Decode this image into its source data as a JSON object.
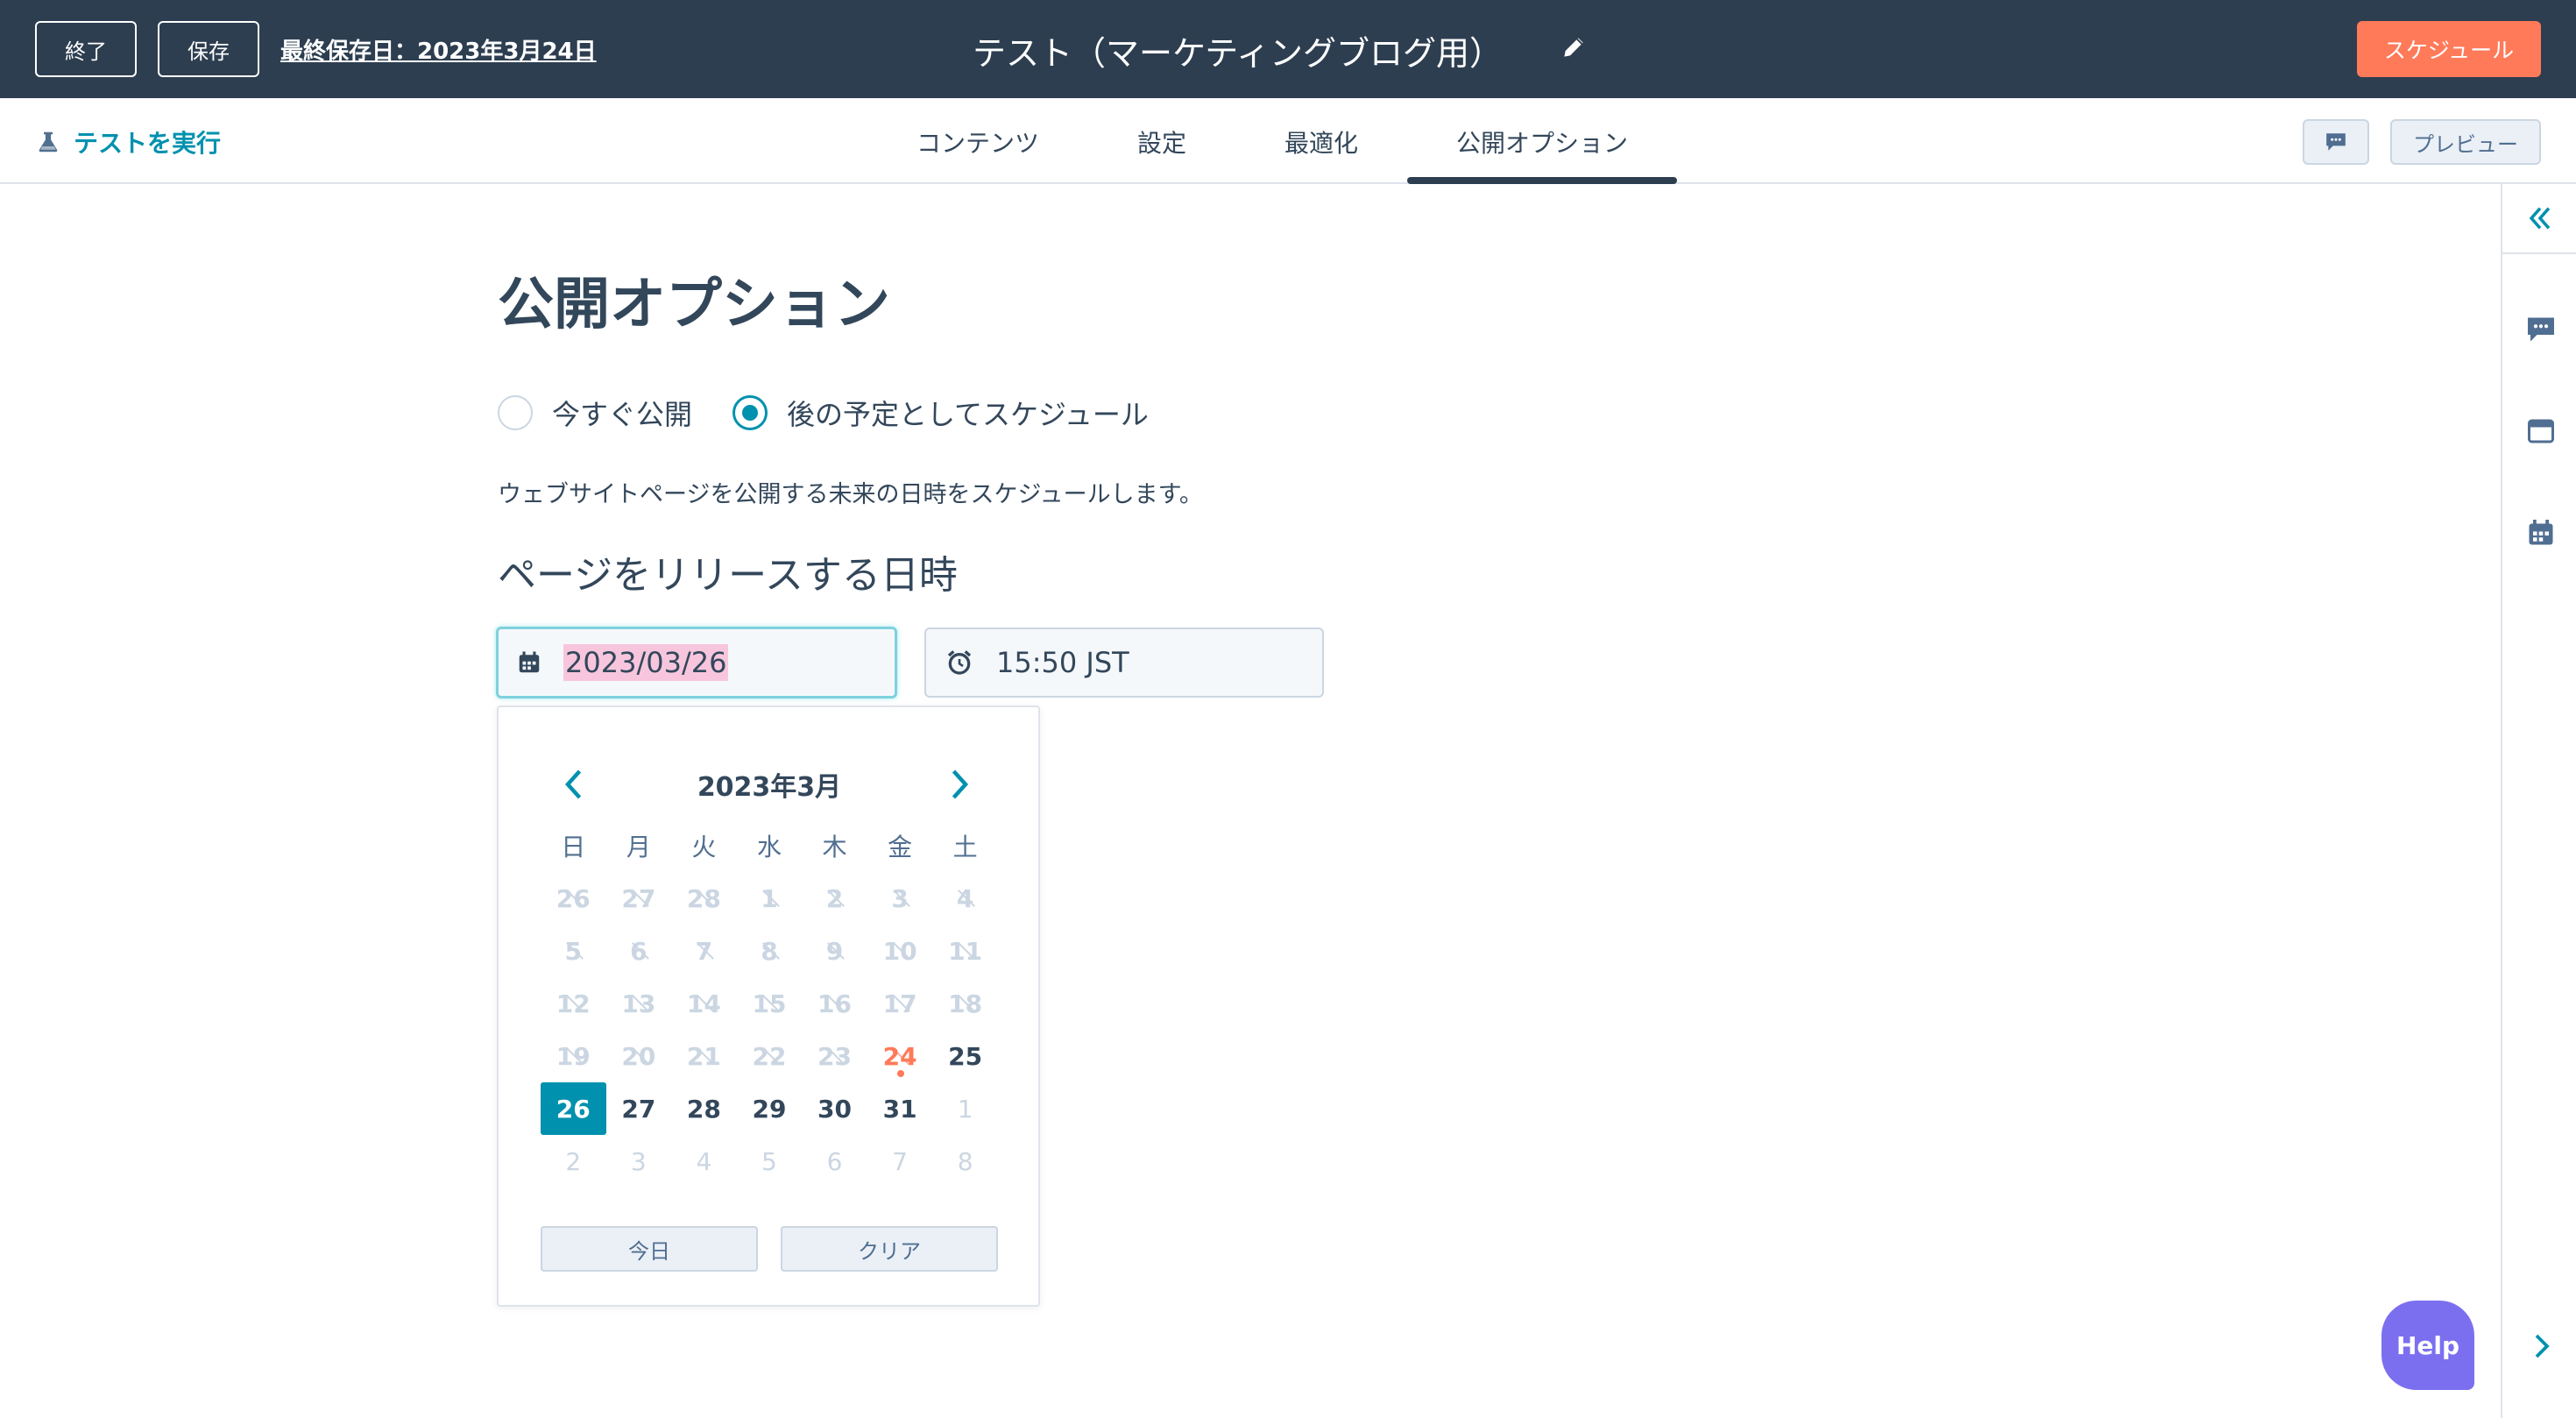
{
  "topbar": {
    "exit_label": "終了",
    "save_label": "保存",
    "last_saved": "最終保存日：2023年3月24日",
    "title": "テスト（マーケティングブログ用）",
    "schedule_label": "スケジュール"
  },
  "tabbar": {
    "run_test_label": "テストを実行",
    "tabs": [
      "コンテンツ",
      "設定",
      "最適化",
      "公開オプション"
    ],
    "active_tab": "公開オプション",
    "preview_label": "プレビュー"
  },
  "main": {
    "heading": "公開オプション",
    "radio_publish_now": "今すぐ公開",
    "radio_schedule_later": "後の予定としてスケジュール",
    "selected_option": "後の予定としてスケジュール",
    "description": "ウェブサイトページを公開する未来の日時をスケジュールします。",
    "subheading": "ページをリリースする日時",
    "date_value": "2023/03/26",
    "time_value": "15:50 JST"
  },
  "calendar": {
    "month_label": "2023年3月",
    "weekdays": [
      "日",
      "月",
      "火",
      "水",
      "木",
      "金",
      "土"
    ],
    "weeks": [
      [
        "26",
        "27",
        "28",
        "1",
        "2",
        "3",
        "4"
      ],
      [
        "5",
        "6",
        "7",
        "8",
        "9",
        "10",
        "11"
      ],
      [
        "12",
        "13",
        "14",
        "15",
        "16",
        "17",
        "18"
      ],
      [
        "19",
        "20",
        "21",
        "22",
        "23",
        "24",
        "25"
      ],
      [
        "26",
        "27",
        "28",
        "29",
        "30",
        "31",
        "1"
      ],
      [
        "2",
        "3",
        "4",
        "5",
        "6",
        "7",
        "8"
      ]
    ],
    "today_label": "今日",
    "clear_label": "クリア",
    "today_day": "24",
    "selected_day": "26"
  },
  "help_label": "Help",
  "colors": {
    "topbar_bg": "#2d3e50",
    "accent_teal": "#0091ae",
    "schedule_orange": "#ff7a59",
    "help_purple": "#7b6ff0"
  },
  "icons": [
    "pencil-icon",
    "flask-icon",
    "chat-icon",
    "calendar-icon",
    "alarm-clock-icon",
    "double-chevron-left-icon",
    "comment-icon",
    "browser-icon",
    "calendar-grid-icon",
    "chevron-right-icon"
  ]
}
